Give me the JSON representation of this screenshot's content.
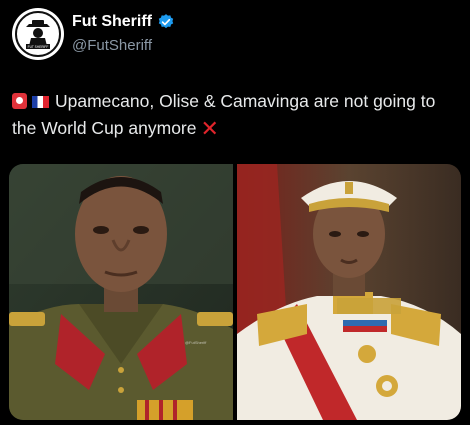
{
  "post": {
    "author": {
      "display_name": "Fut Sheriff",
      "handle": "@FutSheriff",
      "verified": true,
      "verified_color": "#1d9bf0",
      "avatar_icon": "sheriff-logo-icon",
      "avatar_label": "FUT SHERIFF"
    },
    "text": {
      "body": "Upamecano, Olise & Camavinga are not going to the World Cup anymore",
      "lead_emojis": [
        "red-alert-icon",
        "france-flag-icon"
      ],
      "trail_emoji": "red-x-icon"
    },
    "media": {
      "images": [
        {
          "icon": "olive-uniform-portrait-image",
          "watermark": "@FutSheriff"
        },
        {
          "icon": "white-gold-uniform-portrait-image"
        }
      ]
    }
  },
  "colors": {
    "background": "#000000",
    "text_primary": "#e7e9ea",
    "text_secondary": "#8b98a5",
    "alert_red": "#e0242b"
  }
}
